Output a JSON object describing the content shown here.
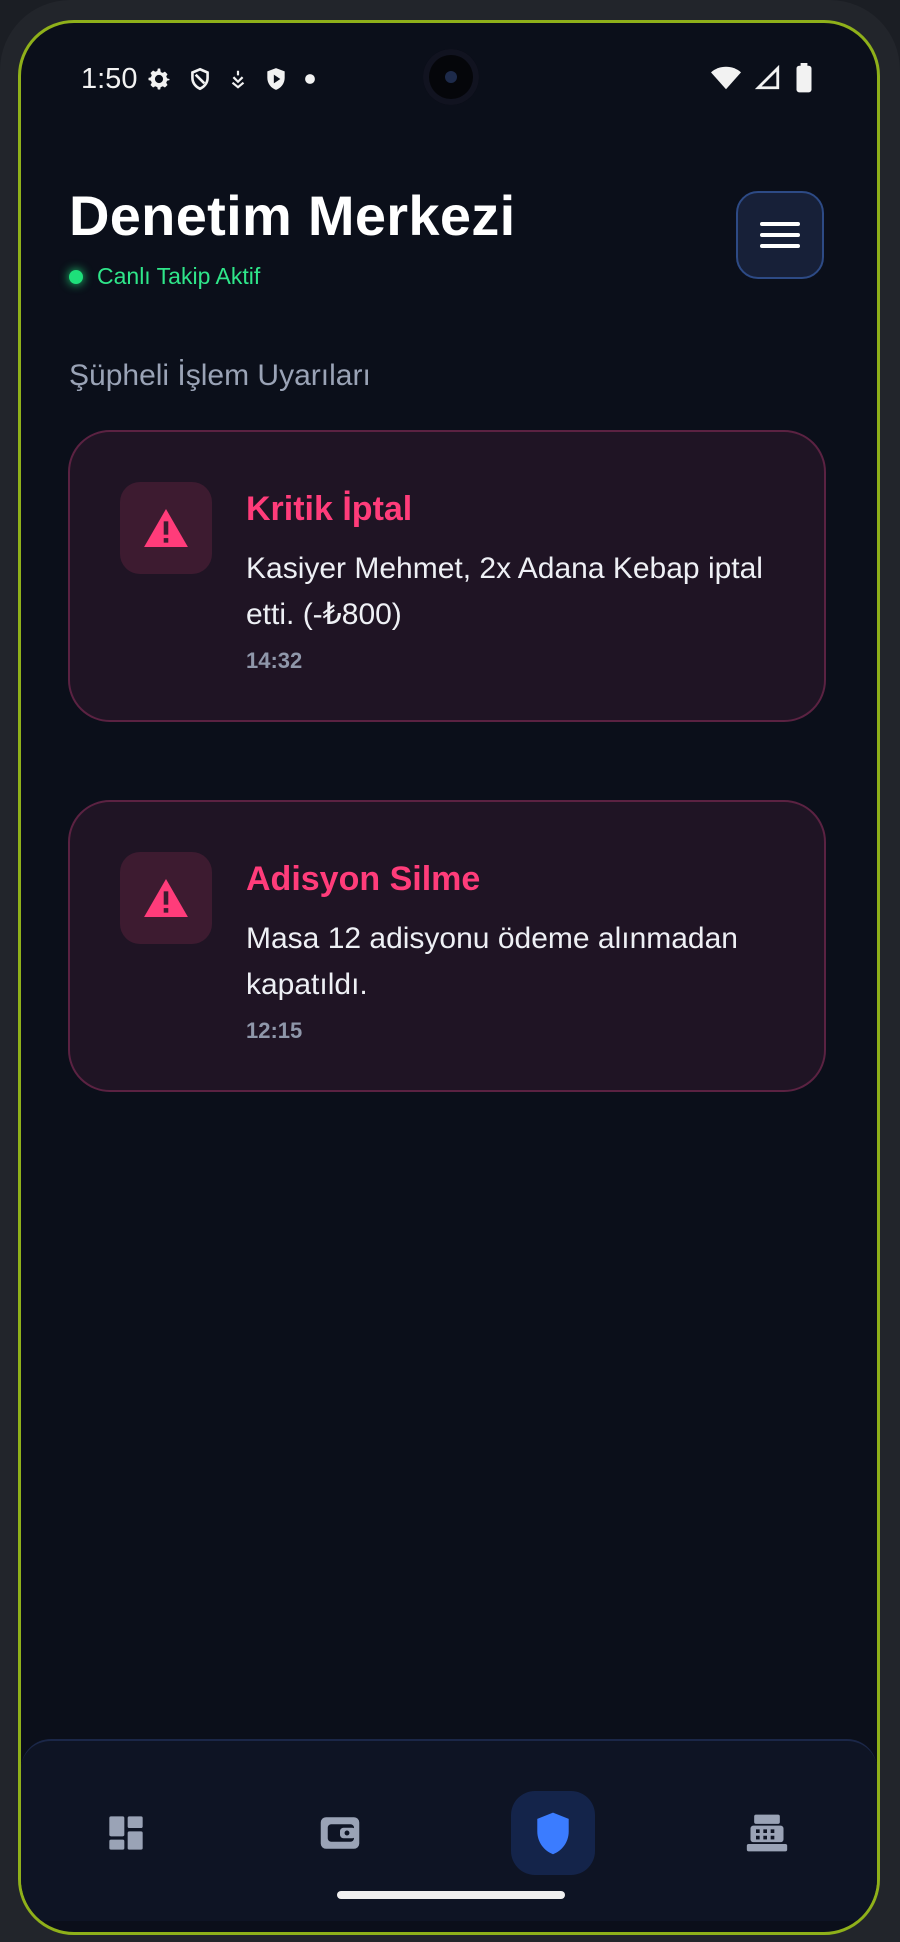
{
  "status_bar": {
    "time": "1:50",
    "left_icons": [
      "settings-icon",
      "shield-outline-icon",
      "pin-icon",
      "shield-play-icon",
      "dot-icon"
    ],
    "right_icons": [
      "wifi-icon",
      "signal-icon",
      "battery-icon"
    ]
  },
  "header": {
    "title": "Denetim Merkezi",
    "live_status": "Canlı Takip Aktif",
    "menu_icon": "hamburger-menu-icon"
  },
  "section": {
    "title": "Şüpheli İşlem Uyarıları"
  },
  "alerts": [
    {
      "title": "Kritik İptal",
      "description": "Kasiyer Mehmet, 2x Adana Kebap iptal etti. (-₺800)",
      "time": "14:32",
      "icon": "warning-icon"
    },
    {
      "title": "Adisyon Silme",
      "description": "Masa 12 adisyonu ödeme alınmadan kapatıldı.",
      "time": "12:15",
      "icon": "warning-icon"
    }
  ],
  "bottom_nav": {
    "items": [
      {
        "icon": "dashboard-icon",
        "active": false
      },
      {
        "icon": "wallet-icon",
        "active": false
      },
      {
        "icon": "shield-icon",
        "active": true
      },
      {
        "icon": "cash-register-icon",
        "active": false
      }
    ]
  },
  "colors": {
    "background": "#0b0f1a",
    "accent_live": "#1ee07a",
    "alert_title": "#ff3c7a",
    "nav_active": "#3b7cff"
  }
}
